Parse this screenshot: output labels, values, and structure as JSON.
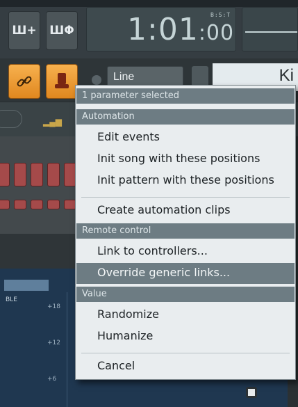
{
  "toolbar": {
    "button1_label": "Ш+",
    "button2_label": "ШΦ",
    "tempo": {
      "main": "1:01",
      "sub": ":00",
      "label": "B:S:T"
    }
  },
  "channel": {
    "line_mode": "Line",
    "instrument_name": "Ki"
  },
  "mixer": {
    "header_label": "BLE",
    "db_marks": [
      "+18",
      "+12",
      "+6"
    ]
  },
  "context_menu": {
    "title": "1 parameter selected",
    "sections": [
      {
        "header": "Automation",
        "items": [
          "Edit events",
          "Init song with these positions",
          "Init pattern with these positions",
          "Create automation clips"
        ]
      },
      {
        "header": "Remote control",
        "items": [
          "Link to controllers...",
          "Override generic links..."
        ]
      },
      {
        "header": "Value",
        "items": [
          "Randomize",
          "Humanize",
          "Cancel"
        ]
      }
    ],
    "highlighted_item": "Override generic links..."
  },
  "colors": {
    "accent_orange": "#f0a040",
    "menu_header": "#6d7c83",
    "menu_background": "#e9edef"
  },
  "icons": [
    "link-icon",
    "knob-icon",
    "equalizer-icon",
    "arrow-right-icon"
  ]
}
